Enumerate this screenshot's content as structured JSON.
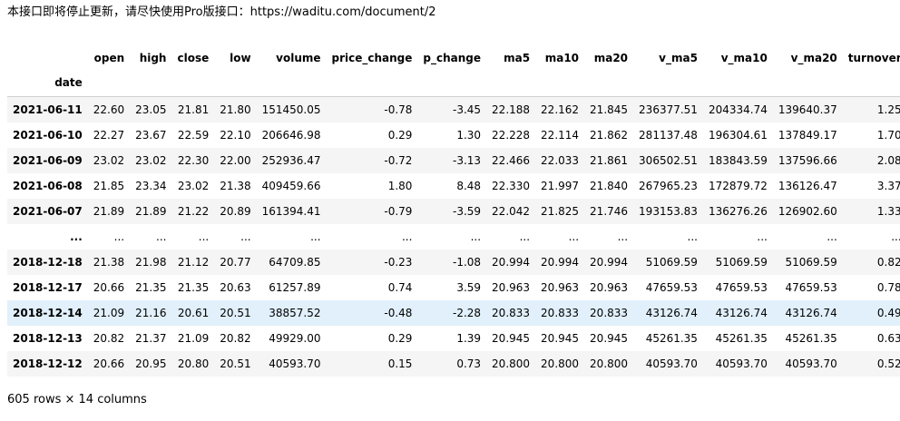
{
  "notice_text": "本接口即将停止更新，请尽快使用Pro版接口：https://waditu.com/document/2",
  "columns": [
    "open",
    "high",
    "close",
    "low",
    "volume",
    "price_change",
    "p_change",
    "ma5",
    "ma10",
    "ma20",
    "v_ma5",
    "v_ma10",
    "v_ma20",
    "turnover"
  ],
  "index_name": "date",
  "rows": [
    {
      "date": "2021-06-11",
      "cells": [
        "22.60",
        "23.05",
        "21.81",
        "21.80",
        "151450.05",
        "-0.78",
        "-3.45",
        "22.188",
        "22.162",
        "21.845",
        "236377.51",
        "204334.74",
        "139640.37",
        "1.25"
      ]
    },
    {
      "date": "2021-06-10",
      "cells": [
        "22.27",
        "23.67",
        "22.59",
        "22.10",
        "206646.98",
        "0.29",
        "1.30",
        "22.228",
        "22.114",
        "21.862",
        "281137.48",
        "196304.61",
        "137849.17",
        "1.70"
      ]
    },
    {
      "date": "2021-06-09",
      "cells": [
        "23.02",
        "23.02",
        "22.30",
        "22.00",
        "252936.47",
        "-0.72",
        "-3.13",
        "22.466",
        "22.033",
        "21.861",
        "306502.51",
        "183843.59",
        "137596.66",
        "2.08"
      ]
    },
    {
      "date": "2021-06-08",
      "cells": [
        "21.85",
        "23.34",
        "23.02",
        "21.38",
        "409459.66",
        "1.80",
        "8.48",
        "22.330",
        "21.997",
        "21.840",
        "267965.23",
        "172879.72",
        "136126.47",
        "3.37"
      ]
    },
    {
      "date": "2021-06-07",
      "cells": [
        "21.89",
        "21.89",
        "21.22",
        "20.89",
        "161394.41",
        "-0.79",
        "-3.59",
        "22.042",
        "21.825",
        "21.746",
        "193153.83",
        "136276.26",
        "126902.60",
        "1.33"
      ]
    },
    {
      "date": "...",
      "cells": [
        "...",
        "...",
        "...",
        "...",
        "...",
        "...",
        "...",
        "...",
        "...",
        "...",
        "...",
        "...",
        "...",
        "..."
      ]
    },
    {
      "date": "2018-12-18",
      "cells": [
        "21.38",
        "21.98",
        "21.12",
        "20.77",
        "64709.85",
        "-0.23",
        "-1.08",
        "20.994",
        "20.994",
        "20.994",
        "51069.59",
        "51069.59",
        "51069.59",
        "0.82"
      ]
    },
    {
      "date": "2018-12-17",
      "cells": [
        "20.66",
        "21.35",
        "21.35",
        "20.63",
        "61257.89",
        "0.74",
        "3.59",
        "20.963",
        "20.963",
        "20.963",
        "47659.53",
        "47659.53",
        "47659.53",
        "0.78"
      ]
    },
    {
      "date": "2018-12-14",
      "cells": [
        "21.09",
        "21.16",
        "20.61",
        "20.51",
        "38857.52",
        "-0.48",
        "-2.28",
        "20.833",
        "20.833",
        "20.833",
        "43126.74",
        "43126.74",
        "43126.74",
        "0.49"
      ],
      "highlight": true
    },
    {
      "date": "2018-12-13",
      "cells": [
        "20.82",
        "21.37",
        "21.09",
        "20.82",
        "49929.00",
        "0.29",
        "1.39",
        "20.945",
        "20.945",
        "20.945",
        "45261.35",
        "45261.35",
        "45261.35",
        "0.63"
      ]
    },
    {
      "date": "2018-12-12",
      "cells": [
        "20.66",
        "20.95",
        "20.80",
        "20.51",
        "40593.70",
        "0.15",
        "0.73",
        "20.800",
        "20.800",
        "20.800",
        "40593.70",
        "40593.70",
        "40593.70",
        "0.52"
      ]
    }
  ],
  "footer": "605 rows × 14 columns",
  "colors": {
    "stripe": "#f5f5f5",
    "highlight_row": "#e1f0fb"
  }
}
